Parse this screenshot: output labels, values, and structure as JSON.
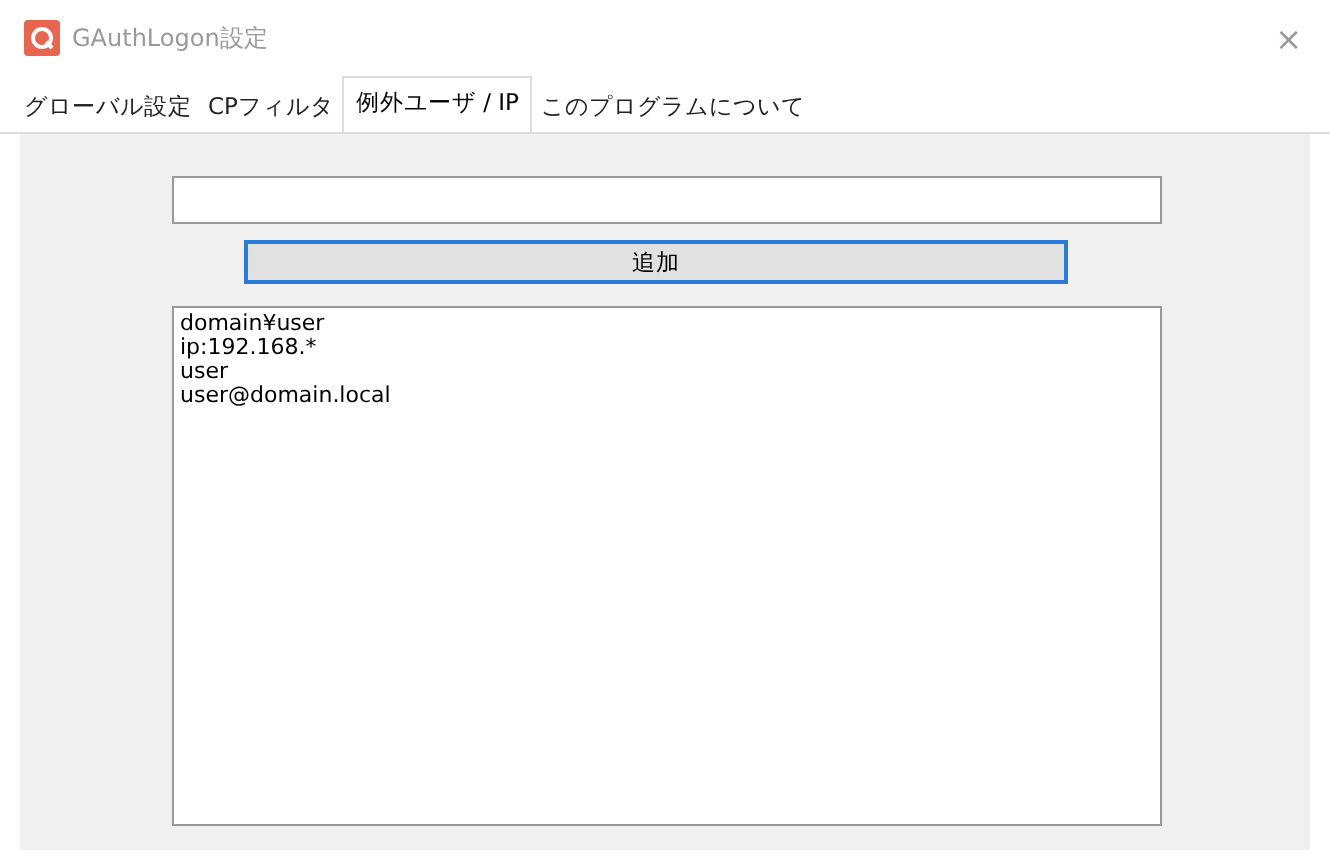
{
  "window": {
    "title": "GAuthLogon設定",
    "close": "×"
  },
  "tabs": [
    {
      "label": "グローバル設定",
      "selected": false
    },
    {
      "label": "CPフィルタ",
      "selected": false
    },
    {
      "label": "例外ユーザ / IP",
      "selected": true
    },
    {
      "label": "このプログラムについて",
      "selected": false
    }
  ],
  "add_button": {
    "label": "追加",
    "focused": true
  },
  "exception_list": [
    "domain¥user",
    "ip:192.168.*",
    "user",
    "user@domain.local"
  ]
}
